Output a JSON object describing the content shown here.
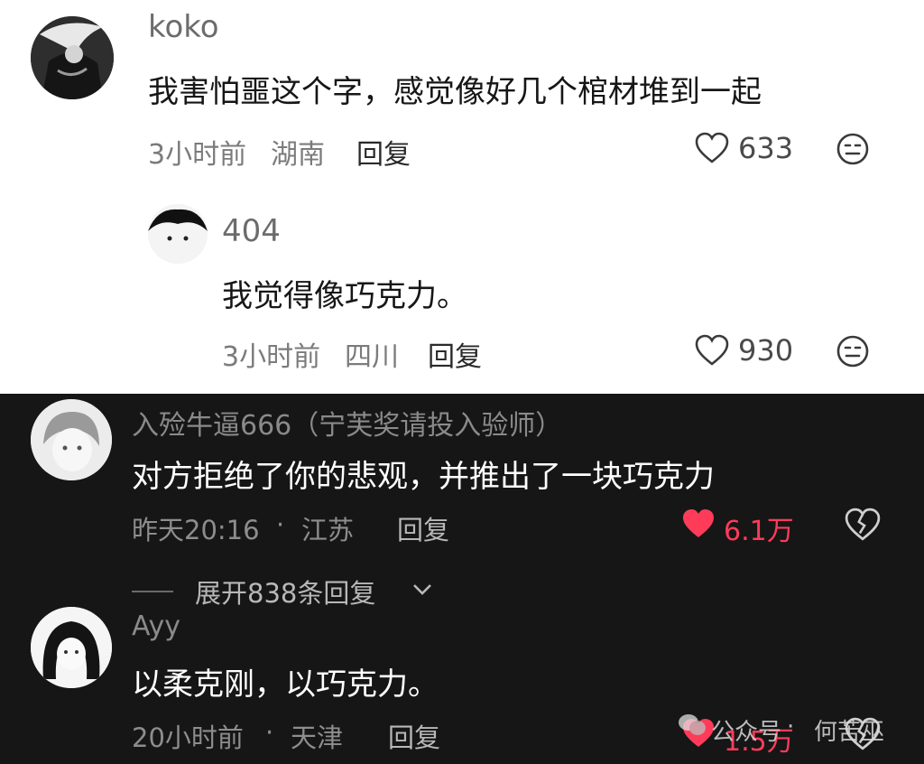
{
  "comments": [
    {
      "username": "koko",
      "text": "我害怕噩这个字，感觉像好几个棺材堆到一起",
      "time": "3小时前",
      "location": "湖南",
      "reply_label": "回复",
      "likes": "633"
    },
    {
      "username": "404",
      "text": "我觉得像巧克力。",
      "time": "3小时前",
      "location": "四川",
      "reply_label": "回复",
      "likes": "930"
    },
    {
      "username": "入殓牛逼666（宁芙奖请投入验师）",
      "text": "对方拒绝了你的悲观，并推出了一块巧克力",
      "time": "昨天20:16",
      "separator": "·",
      "location": "江苏",
      "reply_label": "回复",
      "likes": "6.1万",
      "like_color": "#ff3b5a"
    },
    {
      "username": "Ayy",
      "text": "以柔克刚，以巧克力。",
      "time": "20小时前",
      "separator": "·",
      "location": "天津",
      "reply_label": "回复",
      "likes": "1.5万"
    }
  ],
  "expand_replies": "展开838条回复",
  "watermark": {
    "source": "公众号",
    "separator": "·",
    "author": "何苦巫"
  },
  "icons": {
    "like": "heart-outline-icon",
    "like_active": "heart-filled-icon",
    "dislike": "broken-heart-icon",
    "more": "face-icon",
    "expand": "chevron-down-icon"
  }
}
